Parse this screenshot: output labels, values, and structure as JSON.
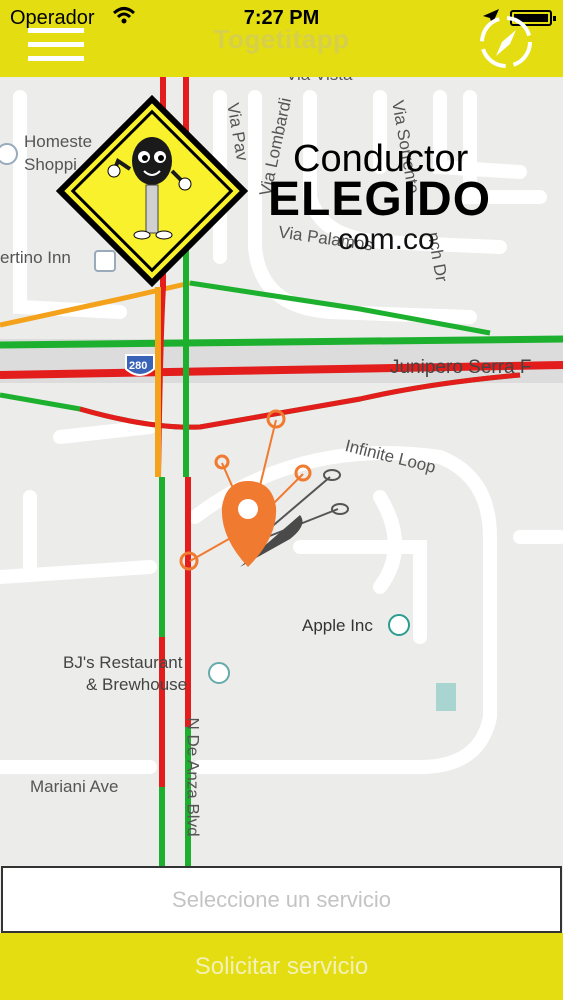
{
  "status_bar": {
    "carrier": "Operador",
    "time": "7:27 PM"
  },
  "nav": {
    "title": "Togetitapp",
    "menu_icon": "hamburger-menu-icon",
    "compass_icon": "compass-icon"
  },
  "logo": {
    "line1": "Conductor",
    "line2": "ELEGIDO",
    "line3": "com.co"
  },
  "map": {
    "labels": {
      "homestead_1": "Homeste",
      "homestead_2": "Shoppi",
      "cupertino_inn": "ertino Inn",
      "via_palamos": "Via Palamos",
      "via_lombardi": "Via Lombardi",
      "via_paviso": "Via Pav",
      "via_sorrento": "Via Sorrento",
      "vista": "Via Vista",
      "finch": "nch Dr",
      "junipero": "Junipero Serra F",
      "highway": "280",
      "infinite_loop": "Infinite Loop",
      "apple": "Apple Inc",
      "bjs_1": "BJ's Restaurant",
      "bjs_2": "& Brewhouse",
      "mariani": "Mariani Ave",
      "de_anza": "N De Anza Blvd"
    },
    "colors": {
      "traffic_green": "#1db02e",
      "traffic_red": "#e31c1c",
      "traffic_orange": "#f4a21b",
      "pin": "#f07a30"
    }
  },
  "bottom": {
    "service_placeholder": "Seleccione un servicio",
    "request_label": "Solicitar servicio"
  }
}
